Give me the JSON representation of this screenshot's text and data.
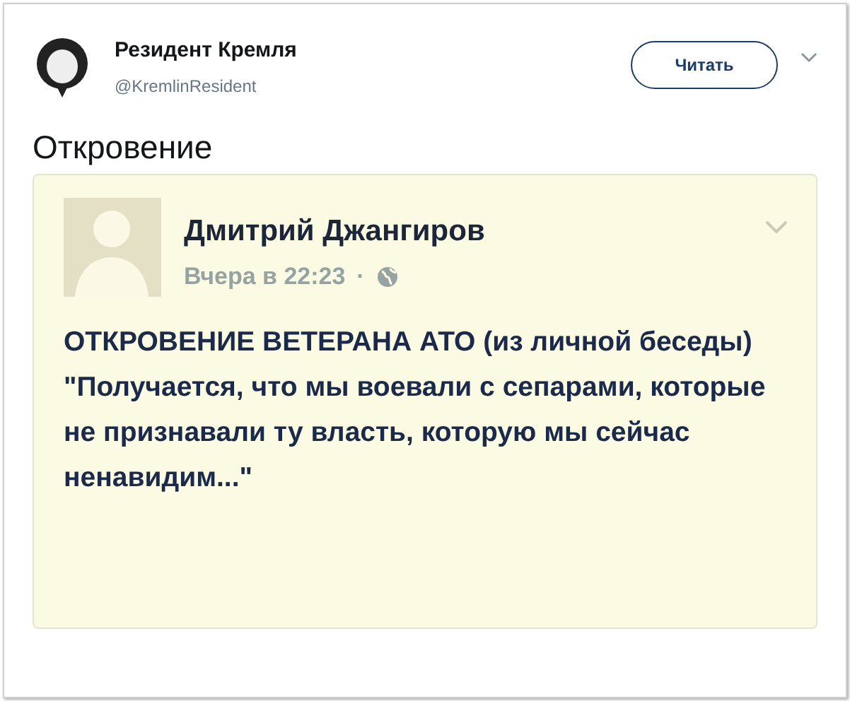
{
  "tweet": {
    "author_name": "Резидент Кремля",
    "handle": "@KremlinResident",
    "follow_button": "Читать",
    "text": "Откровение",
    "embedded_post": {
      "author_name": "Дмитрий Джангиров",
      "time": "Вчера в 22:23",
      "separator": "·",
      "paragraphs": [
        "ОТКРОВЕНИЕ ВЕТЕРАНА АТО (из личной беседы)",
        "\"Получается, что мы воевали с сепарами, которые не признавали ту власть, которую мы сейчас ненавидим...\""
      ]
    }
  }
}
